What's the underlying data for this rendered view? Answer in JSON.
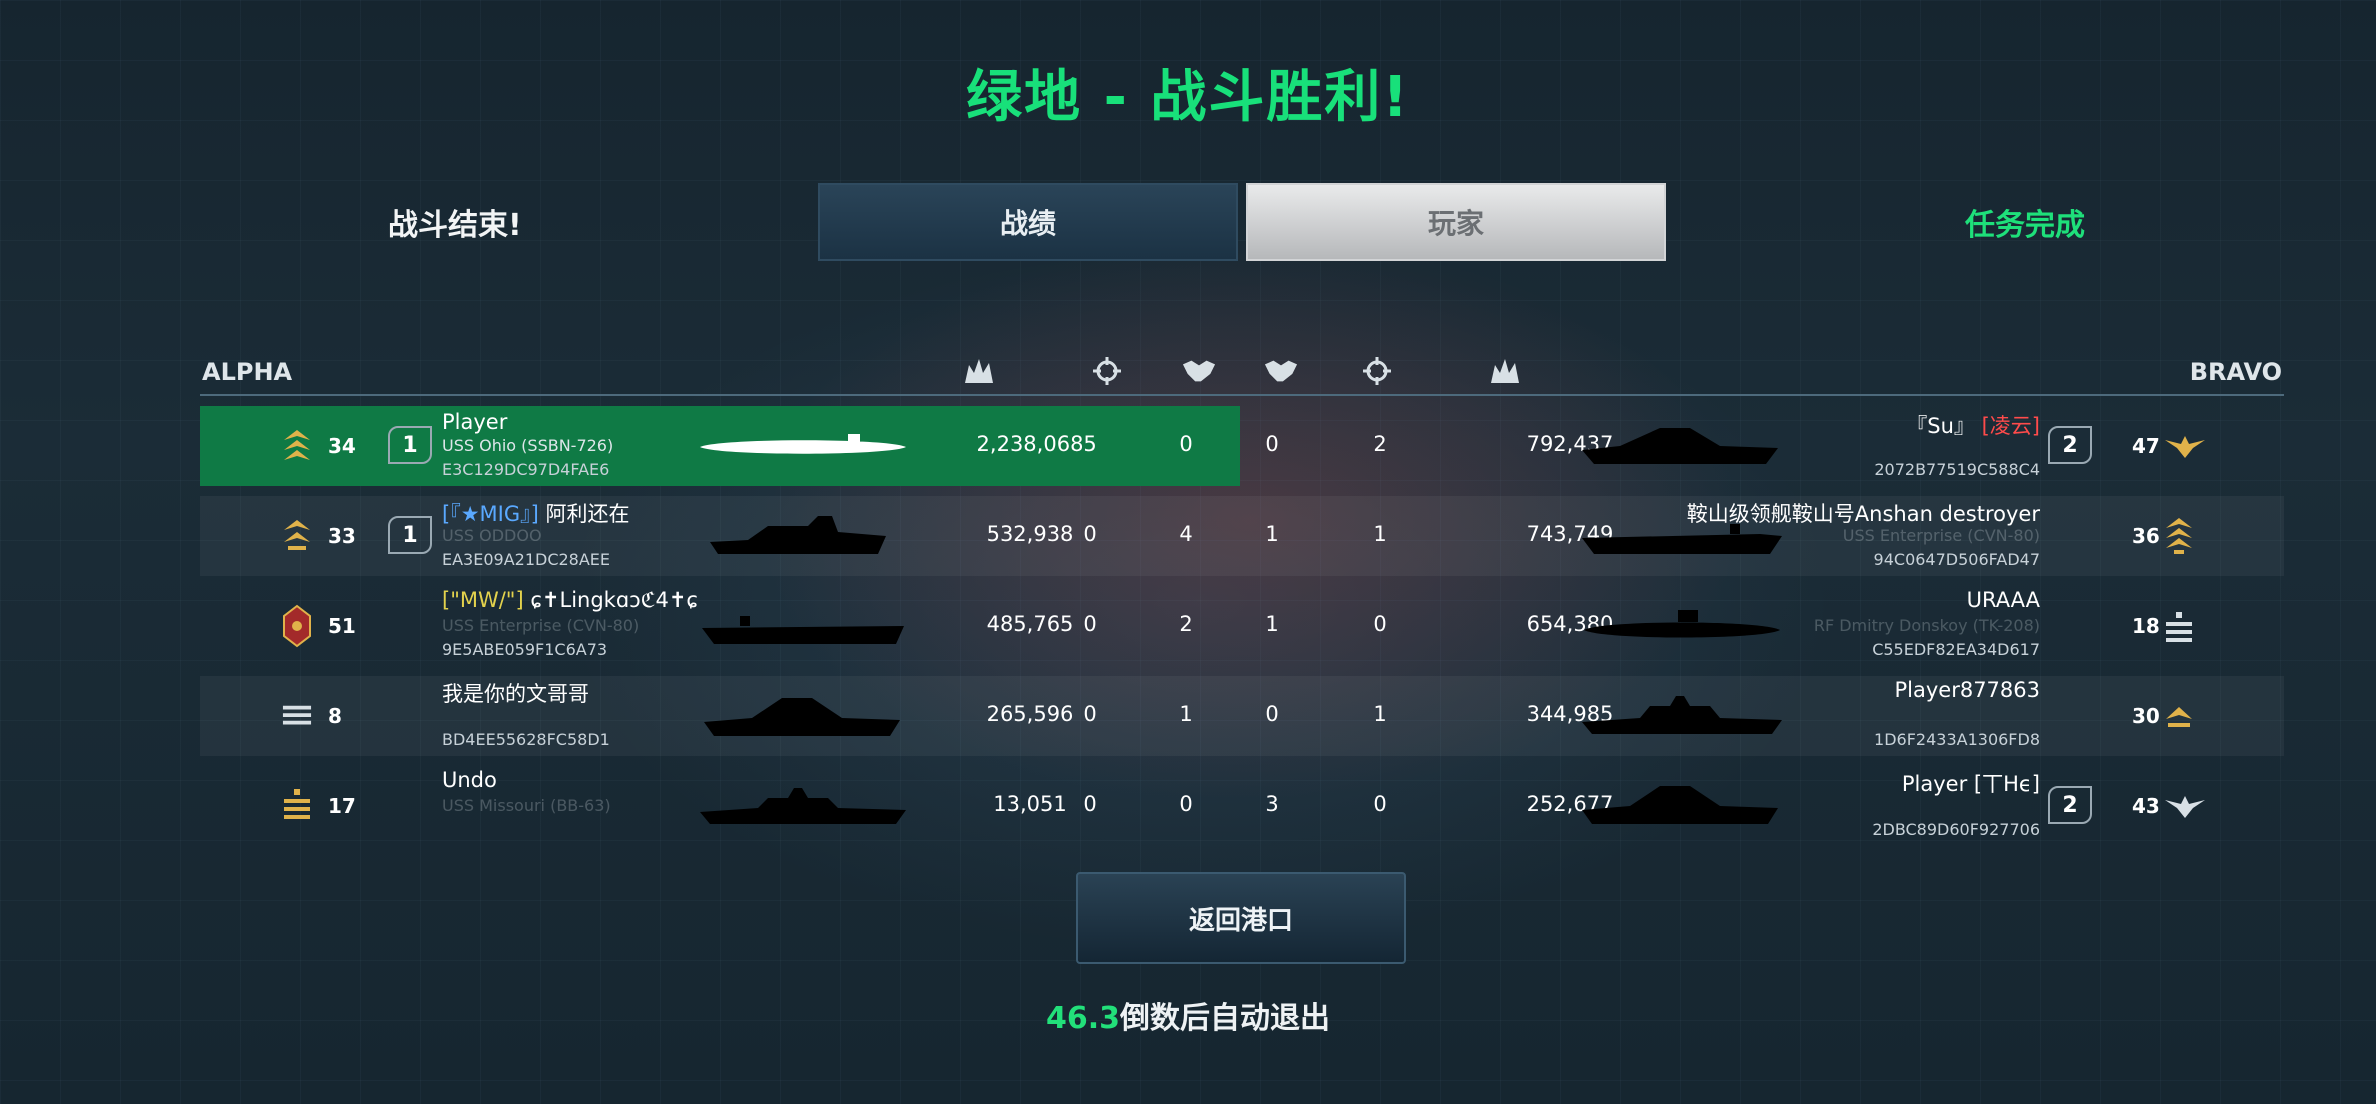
{
  "title": "绿地 - 战斗胜利!",
  "battle_end": "战斗结束!",
  "tabs": {
    "stats": "战绩",
    "players": "玩家"
  },
  "mission_complete": "任务完成",
  "teams": {
    "left": "ALPHA",
    "right": "BRAVO"
  },
  "columns": {
    "left_damage_icon": "explosion-icon",
    "left_kills_icon": "crosshair-icon",
    "left_assists_icon": "handshake-icon",
    "right_assists_icon": "handshake-icon",
    "right_kills_icon": "crosshair-icon",
    "right_damage_icon": "explosion-icon"
  },
  "rows": [
    {
      "highlight": true,
      "left": {
        "rank": "34",
        "squad": "1",
        "name": "Player",
        "name_tag": "",
        "ship": "USS Ohio (SSBN-726)",
        "id": "E3C129DC97D4FAE6",
        "damage": "2,238,068",
        "kills": "5",
        "assists": "0"
      },
      "right": {
        "assists": "0",
        "kills": "2",
        "damage": "792,437",
        "name_tag": "『Su』",
        "name": "[凌云]",
        "ship": "",
        "id": "2072B77519C588C4",
        "squad": "2",
        "rank": "47"
      }
    },
    {
      "highlight": false,
      "left": {
        "rank": "33",
        "squad": "1",
        "name_tag": "[『★MIG』]",
        "name": "阿利还在",
        "ship": "USS ODDOO",
        "id": "EA3E09A21DC28AEE",
        "damage": "532,938",
        "kills": "0",
        "assists": "4"
      },
      "right": {
        "assists": "1",
        "kills": "1",
        "damage": "743,749",
        "name_tag": "",
        "name": "鞍山级领舰鞍山号Anshan destroyer",
        "ship": "USS Enterprise (CVN-80)",
        "id": "94C0647D506FAD47",
        "squad": "",
        "rank": "36"
      }
    },
    {
      "highlight": false,
      "left": {
        "rank": "51",
        "squad": "",
        "name_tag": "[\"MW/\"]",
        "name": "ɕ✝Lingkɑɔℭ4✝ɕ",
        "ship": "USS Enterprise (CVN-80)",
        "id": "9E5ABE059F1C6A73",
        "damage": "485,765",
        "kills": "0",
        "assists": "2"
      },
      "right": {
        "assists": "1",
        "kills": "0",
        "damage": "654,380",
        "name_tag": "",
        "name": "URAAA",
        "ship": "RF Dmitry Donskoy (TK-208)",
        "id": "C55EDF82EA34D617",
        "squad": "",
        "rank": "18"
      }
    },
    {
      "highlight": false,
      "left": {
        "rank": "8",
        "squad": "",
        "name_tag": "",
        "name": "我是你的文哥哥",
        "ship": "",
        "id": "BD4EE55628FC58D1",
        "damage": "265,596",
        "kills": "0",
        "assists": "1"
      },
      "right": {
        "assists": "0",
        "kills": "1",
        "damage": "344,985",
        "name_tag": "",
        "name": "Player877863",
        "ship": "",
        "id": "1D6F2433A1306FD8",
        "squad": "",
        "rank": "30"
      }
    },
    {
      "highlight": false,
      "left": {
        "rank": "17",
        "squad": "",
        "name_tag": "",
        "name": "Undo",
        "ship": "USS Missouri (BB-63)",
        "id": "",
        "damage": "13,051",
        "kills": "0",
        "assists": "0"
      },
      "right": {
        "assists": "3",
        "kills": "0",
        "damage": "252,677",
        "name_tag": "",
        "name": "Player [丅Hϵ]",
        "ship": "",
        "id": "2DBC89D60F927706",
        "squad": "2",
        "rank": "43"
      }
    }
  ],
  "return_button": "返回港口",
  "countdown": {
    "value": "46.3",
    "text": "倒数后自动退出"
  },
  "colors": {
    "accent_green": "#18e07a",
    "highlight_row": "#0f7a45",
    "rank_gold": "#e0b24a"
  }
}
